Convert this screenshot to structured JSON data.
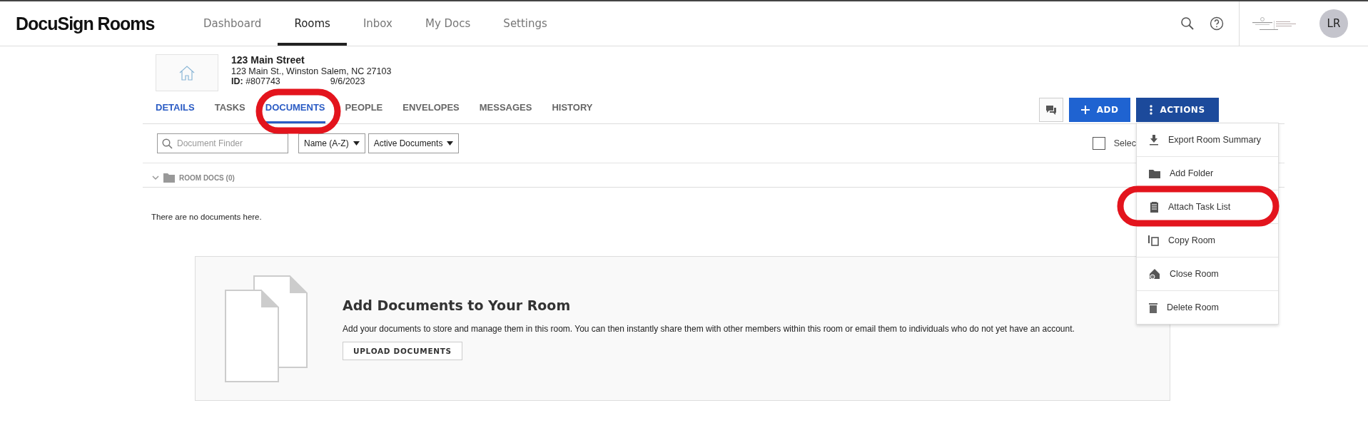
{
  "app": {
    "logo": "DocuSign Rooms",
    "avatar": "LR"
  },
  "nav": [
    {
      "label": "Dashboard",
      "selected": false
    },
    {
      "label": "Rooms",
      "selected": true
    },
    {
      "label": "Inbox",
      "selected": false
    },
    {
      "label": "My Docs",
      "selected": false
    },
    {
      "label": "Settings",
      "selected": false
    }
  ],
  "room": {
    "title": "123 Main Street",
    "address": "123 Main St., Winston Salem, NC 27103",
    "id_label": "ID:",
    "id": "#807743",
    "created_date": "9/6/2023"
  },
  "tabs": [
    {
      "label": "DETAILS",
      "selected": false
    },
    {
      "label": "TASKS",
      "selected": false
    },
    {
      "label": "DOCUMENTS",
      "selected": true
    },
    {
      "label": "PEOPLE",
      "selected": false
    },
    {
      "label": "ENVELOPES",
      "selected": false
    },
    {
      "label": "MESSAGES",
      "selected": false
    },
    {
      "label": "HISTORY",
      "selected": false
    }
  ],
  "add_button": "ADD",
  "actions": {
    "label": "ACTIONS",
    "expanded": true,
    "items": [
      {
        "kind": "export",
        "label": "Export Room Summary"
      },
      {
        "kind": "folder",
        "label": "Add Folder"
      },
      {
        "kind": "tasklist",
        "label": "Attach Task List"
      },
      {
        "kind": "copy",
        "label": "Copy Room"
      },
      {
        "kind": "close",
        "label": "Close Room"
      },
      {
        "kind": "delete",
        "label": "Delete Room"
      }
    ]
  },
  "filters": {
    "finder_placeholder": "Document Finder",
    "sort": "Name (A-Z)",
    "status": "Active Documents",
    "select_all": {
      "label": "Selec",
      "checked": false
    }
  },
  "folder": {
    "name": "ROOM DOCS (0)",
    "expanded": true
  },
  "empty_message": "There are no documents here.",
  "card": {
    "title": "Add Documents to Your Room",
    "text": "Add your documents to store and manage them in this room. You can then instantly share them with other members within this room or email them to individuals who do not yet have an account.",
    "button": "UPLOAD DOCUMENTS"
  },
  "annotations": [
    {
      "kind": "circle"
    },
    {
      "kind": "circle"
    }
  ]
}
